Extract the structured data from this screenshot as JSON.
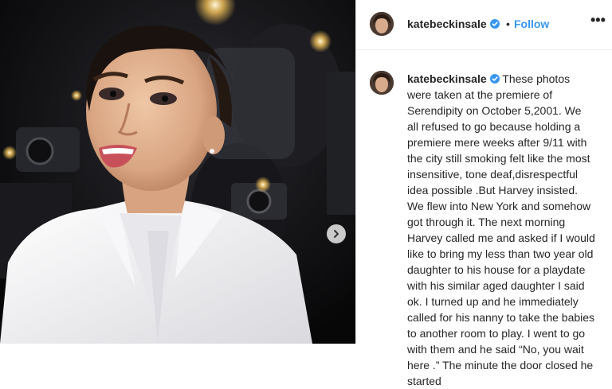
{
  "post": {
    "username": "katebeckinsale",
    "dot": "•",
    "follow_label": "Follow",
    "more_label": "•••",
    "caption": "These photos were taken at the premiere of Serendipity on October 5,2001. We all refused to go because holding a premiere mere weeks after 9/11 with the city still smoking felt like the most insensitive, tone deaf,disrespectful idea possible .But Harvey insisted. We flew into New York and somehow got through it. The next morning Harvey called me and asked if I would like to bring my less than two year old daughter to his house for a playdate with his similar aged daughter I said ok. I turned up and he immediately called for his nanny to take the babies to another room to play. I went to go with them and he said “No, you wait here .” The minute the door closed he started"
  },
  "icons": {
    "verified": "verified-badge-icon",
    "next": "chevron-right-icon",
    "more": "more-options-icon"
  },
  "colors": {
    "accent": "#3897f0",
    "text": "#262626",
    "divider": "#dbdbdb",
    "photo_bg": "#0c0c0e",
    "suit": "#f1f1f1"
  }
}
